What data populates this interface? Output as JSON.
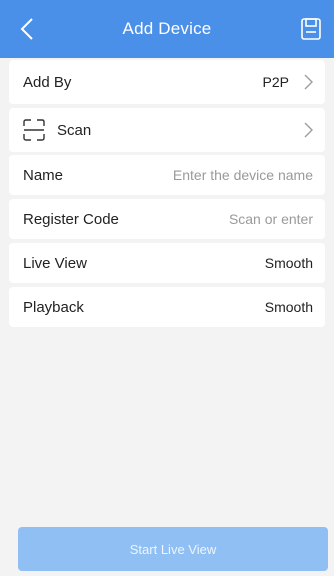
{
  "header": {
    "title": "Add Device",
    "back_icon": "chevron-left-icon",
    "save_icon": "save-icon",
    "color": "#4a90e8"
  },
  "add_by": {
    "label": "Add By",
    "value": "P2P"
  },
  "scan": {
    "label": "Scan",
    "icon": "scan-frame-icon"
  },
  "fields": {
    "name": {
      "label": "Name",
      "placeholder": "Enter the device name"
    },
    "register_code": {
      "label": "Register Code",
      "placeholder": "Scan or enter"
    },
    "live_view": {
      "label": "Live View",
      "value": "Smooth"
    },
    "playback": {
      "label": "Playback",
      "value": "Smooth"
    }
  },
  "start_button": {
    "label": "Start Live View"
  }
}
